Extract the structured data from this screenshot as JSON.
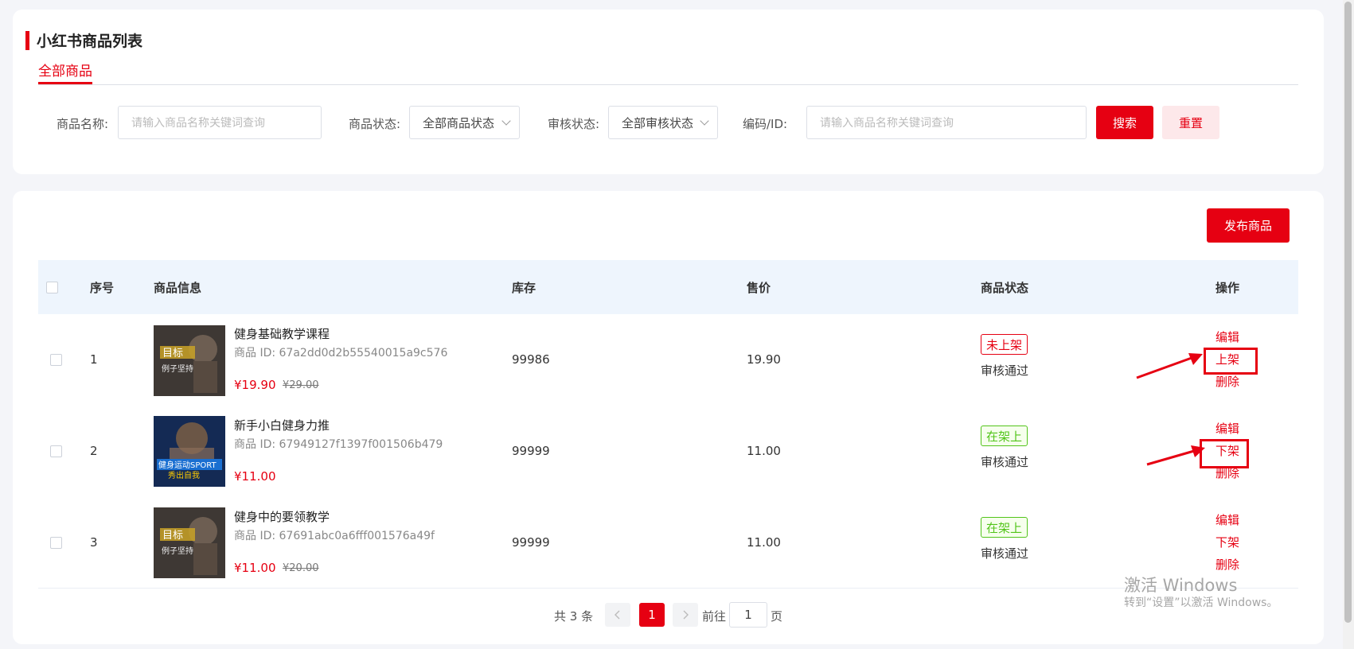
{
  "header": {
    "title": "小红书商品列表",
    "tab": "全部商品"
  },
  "filters": {
    "name_label": "商品名称:",
    "name_placeholder": "请输入商品名称关键词查询",
    "status_label": "商品状态:",
    "status_value": "全部商品状态",
    "audit_label": "审核状态:",
    "audit_value": "全部审核状态",
    "code_label": "编码/ID:",
    "code_placeholder": "请输入商品名称关键词查询",
    "search_label": "搜索",
    "reset_label": "重置"
  },
  "publish_label": "发布商品",
  "table": {
    "headers": [
      "序号",
      "商品信息",
      "库存",
      "售价",
      "商品状态",
      "操作"
    ],
    "rows": [
      {
        "index": "1",
        "name": "健身基础教学课程",
        "id": "商品 ID:  67a2dd0d2b55540015a9c576",
        "price": "¥19.90",
        "orig_price": "¥29.00",
        "stock": "99986",
        "sale": "19.90",
        "status": "未上架",
        "audit": "审核通过",
        "op_edit": "编辑",
        "op_toggle": "上架",
        "op_delete": "删除"
      },
      {
        "index": "2",
        "name": "新手小白健身力推",
        "id": "商品 ID:  67949127f1397f001506b479",
        "price": "¥11.00",
        "orig_price": "",
        "stock": "99999",
        "sale": "11.00",
        "status": "在架上",
        "audit": "审核通过",
        "op_edit": "编辑",
        "op_toggle": "下架",
        "op_delete": "删除"
      },
      {
        "index": "3",
        "name": "健身中的要领教学",
        "id": "商品 ID:  67691abc0a6fff001576a49f",
        "price": "¥11.00",
        "orig_price": "¥20.00",
        "stock": "99999",
        "sale": "11.00",
        "status": "在架上",
        "audit": "审核通过",
        "op_edit": "编辑",
        "op_toggle": "下架",
        "op_delete": "删除"
      }
    ]
  },
  "pagination": {
    "total": "共 3 条",
    "current": "1",
    "goto": "前往",
    "page_input": "1",
    "unit": "页"
  },
  "watermark": {
    "line1": "激活 Windows",
    "line2": "转到“设置”以激活 Windows。"
  },
  "colors": {
    "accent": "#e60012",
    "on_shelf": "#52c41a",
    "header_bg": "#eef5fd",
    "page_bg": "#f4f5f9"
  }
}
